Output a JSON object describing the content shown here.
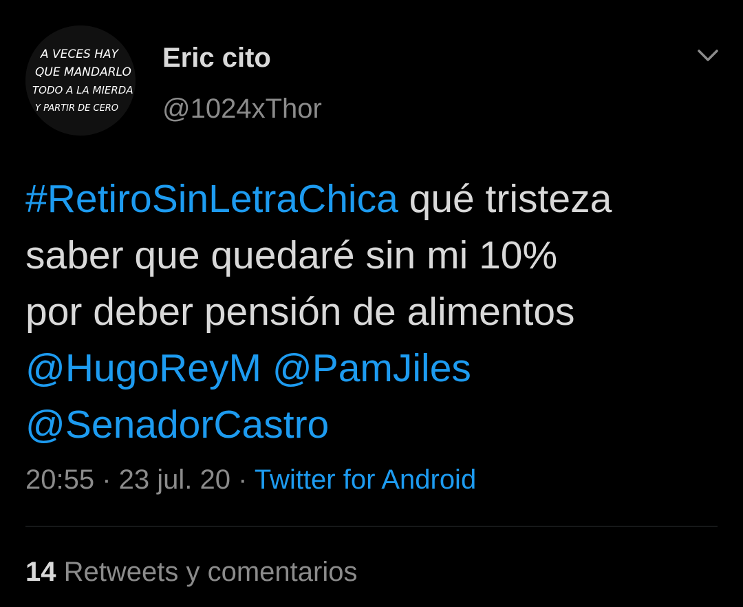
{
  "theme": {
    "background": "#000000",
    "text_primary": "#d9d9d9",
    "text_secondary": "#8b8b8b",
    "link": "#1d9bf0",
    "divider": "#2f3336"
  },
  "author": {
    "avatar_text_lines": [
      "A VECES HAY",
      "QUE MANDARLO",
      "TODO A LA MIERDA",
      "Y PARTIR DE CERO"
    ],
    "display_name": "Eric cito",
    "handle": "@1024xThor"
  },
  "menu": {
    "icon": "chevron-down-icon"
  },
  "tweet": {
    "hashtag": "#RetiroSinLetraChica",
    "text_line1_rest": " qué tristeza",
    "text_line2": "saber que quedaré sin mi 10%",
    "text_line3": "por deber pensión de alimentos",
    "mentions": [
      "@HugoReyM",
      "@PamJiles",
      "@SenadorCastro"
    ]
  },
  "meta": {
    "time": "20:55",
    "separator": " · ",
    "date": "23 jul. 20",
    "source": "Twitter for Android"
  },
  "stats": {
    "retweets_count": "14",
    "retweets_label": " Retweets y comentarios"
  }
}
